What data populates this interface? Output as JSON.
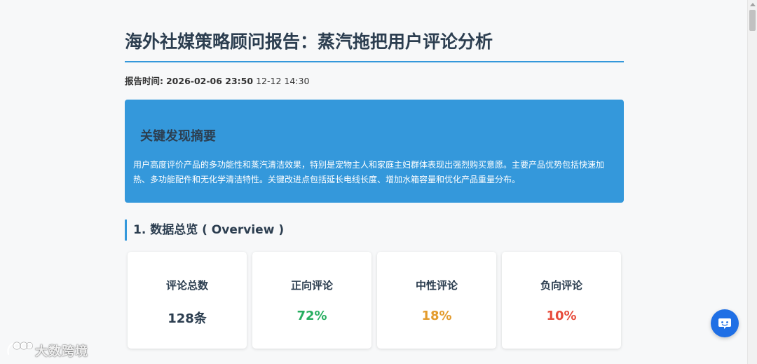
{
  "report": {
    "title": "海外社媒策略顾问报告：蒸汽拖把用户评论分析",
    "time_label": "报告时间:",
    "time_value": "2026-02-06 23:50",
    "time_extra": "12-12 14:30"
  },
  "summary": {
    "title": "关键发现摘要",
    "text": "用户高度评价产品的多功能性和蒸汽清洁效果，特别是宠物主人和家庭主妇群体表现出强烈购买意愿。主要产品优势包括快速加热、多功能配件和无化学清洁特性。关键改进点包括延长电线长度、增加水箱容量和优化产品重量分布。"
  },
  "overview": {
    "heading": "1. 数据总览 ( Overview )",
    "cards": [
      {
        "label": "评论总数",
        "value": "128条",
        "color": "#2c3e50"
      },
      {
        "label": "正向评论",
        "value": "72%",
        "color": "#27ae60"
      },
      {
        "label": "中性评论",
        "value": "18%",
        "color": "#e39b2c"
      },
      {
        "label": "负向评论",
        "value": "10%",
        "color": "#e74c3c"
      }
    ]
  },
  "watermark": {
    "text": "大数跨境"
  },
  "icons": {
    "chat": "chat-bubble-icon",
    "logo": "dashu-logo-icon"
  }
}
